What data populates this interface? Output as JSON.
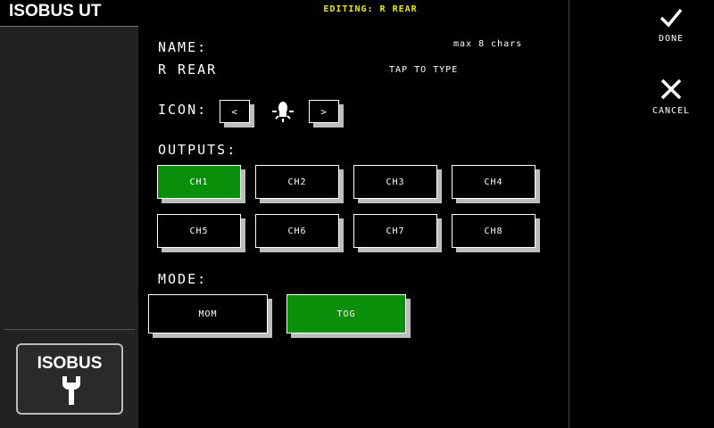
{
  "app_title": "ISOBUS UT",
  "sidebar": {
    "isobus_button_label": "ISOBUS"
  },
  "header": {
    "editing_text": "EDITING: R REAR"
  },
  "actions": {
    "done_label": "DONE",
    "cancel_label": "CANCEL"
  },
  "name": {
    "label": "NAME:",
    "value": "R REAR",
    "hint": "max 8 chars",
    "tap_hint": "TAP TO TYPE"
  },
  "icon": {
    "label": "ICON:",
    "prev": "<",
    "next": ">",
    "current": "bulb-icon"
  },
  "outputs": {
    "label": "OUTPUTS:",
    "channels": [
      {
        "label": "CH1",
        "active": true
      },
      {
        "label": "CH2",
        "active": false
      },
      {
        "label": "CH3",
        "active": false
      },
      {
        "label": "CH4",
        "active": false
      },
      {
        "label": "CH5",
        "active": false
      },
      {
        "label": "CH6",
        "active": false
      },
      {
        "label": "CH7",
        "active": false
      },
      {
        "label": "CH8",
        "active": false
      }
    ]
  },
  "mode": {
    "label": "MODE:",
    "options": [
      {
        "label": "MOM",
        "active": false
      },
      {
        "label": "TOG",
        "active": true
      }
    ]
  },
  "colors": {
    "active_green": "#0a8f0a",
    "header_yellow": "#e8e800"
  }
}
